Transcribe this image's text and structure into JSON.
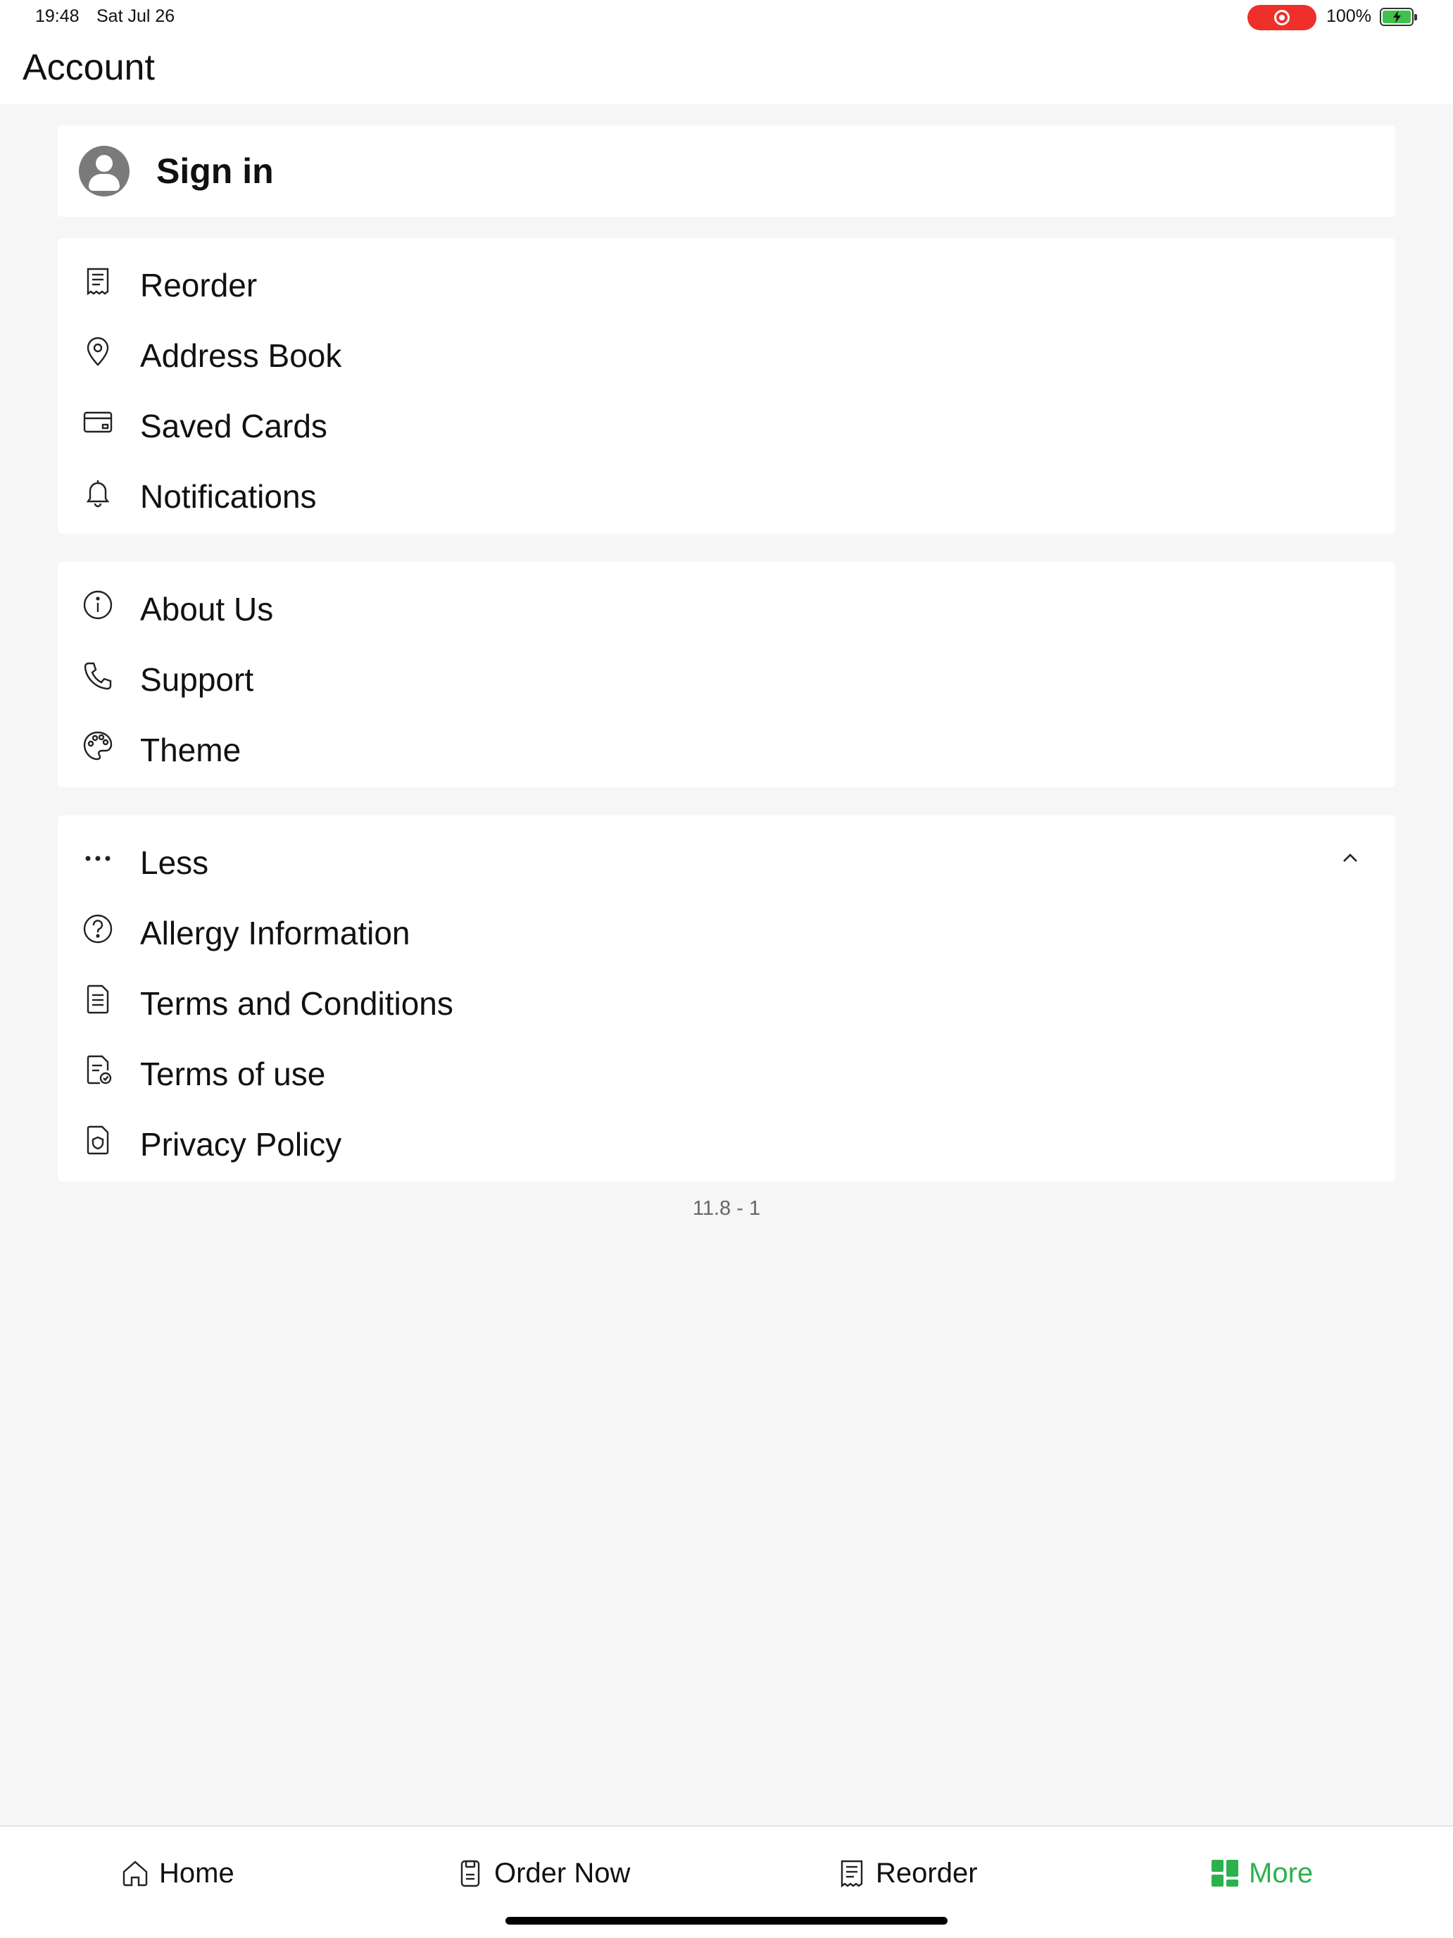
{
  "status_bar": {
    "time": "19:48",
    "date": "Sat Jul 26",
    "battery_percent": "100%",
    "recording_color": "#ee2f2a",
    "battery_color": "#3ec24c"
  },
  "header": {
    "title": "Account"
  },
  "signin": {
    "label": "Sign in",
    "icon": "user-avatar-icon"
  },
  "account_section": [
    {
      "label": "Reorder",
      "icon": "receipt-icon"
    },
    {
      "label": "Address Book",
      "icon": "location-pin-icon"
    },
    {
      "label": "Saved Cards",
      "icon": "credit-card-icon"
    },
    {
      "label": "Notifications",
      "icon": "bell-icon"
    }
  ],
  "info_section": [
    {
      "label": "About Us",
      "icon": "info-icon"
    },
    {
      "label": "Support",
      "icon": "phone-icon"
    },
    {
      "label": "Theme",
      "icon": "palette-icon"
    }
  ],
  "more_section": {
    "toggle_label": "Less",
    "toggle_icon": "ellipsis-icon",
    "expanded": true,
    "items": [
      {
        "label": "Allergy Information",
        "icon": "question-circle-icon"
      },
      {
        "label": "Terms and Conditions",
        "icon": "document-list-icon"
      },
      {
        "label": "Terms of use",
        "icon": "document-check-icon"
      },
      {
        "label": "Privacy Policy",
        "icon": "shield-document-icon"
      }
    ]
  },
  "version": "11.8 - 1",
  "tab_bar": {
    "accent_color": "#2bb24c",
    "tabs": [
      {
        "label": "Home",
        "icon": "home-icon",
        "active": false
      },
      {
        "label": "Order Now",
        "icon": "order-icon",
        "active": false
      },
      {
        "label": "Reorder",
        "icon": "receipt-icon",
        "active": false
      },
      {
        "label": "More",
        "icon": "grid-icon",
        "active": true
      }
    ]
  }
}
